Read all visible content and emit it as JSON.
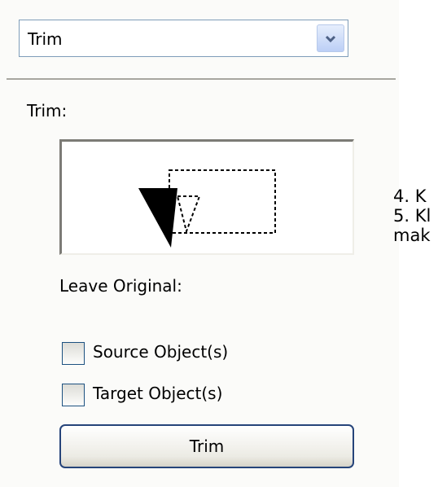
{
  "dropdown": {
    "selected": "Trim",
    "arrow_icon": "chevron-down-icon"
  },
  "section_label": "Trim:",
  "leave_original": {
    "label": "Leave Original:",
    "options": [
      {
        "label": "Source Object(s)",
        "checked": false
      },
      {
        "label": "Target Object(s)",
        "checked": false
      }
    ]
  },
  "trim_button_label": "Trim",
  "side_text": {
    "line1": "4. K",
    "line2": "5. Kl",
    "line3": "mak"
  },
  "colors": {
    "dropdown_border": "#7f9db9",
    "button_border": "#26447a",
    "checkbox_border": "#1c5180"
  }
}
